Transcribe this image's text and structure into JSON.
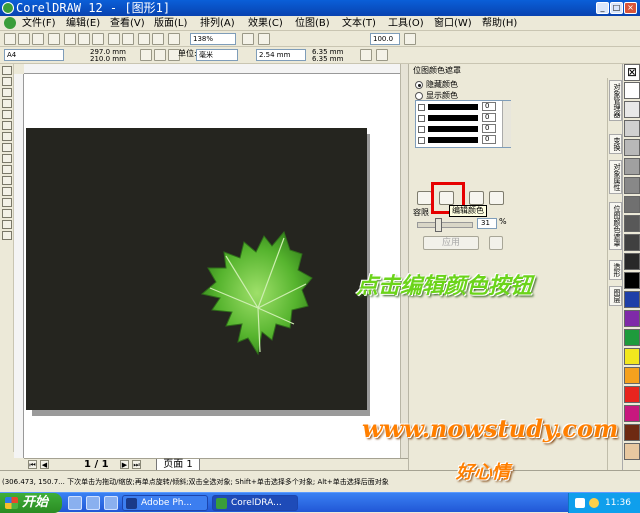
{
  "window": {
    "title": "CorelDRAW 12 - [图形1]"
  },
  "menu": [
    {
      "label": "文件(F)"
    },
    {
      "label": "编辑(E)"
    },
    {
      "label": "查看(V)"
    },
    {
      "label": "版面(L)"
    },
    {
      "label": "排列(A)"
    },
    {
      "label": "效果(C)"
    },
    {
      "label": "位图(B)"
    },
    {
      "label": "文本(T)"
    },
    {
      "label": "工具(O)"
    },
    {
      "label": "窗口(W)"
    },
    {
      "label": "帮助(H)"
    }
  ],
  "toolbar": {
    "zoom": "138%",
    "zoom2": "100.0"
  },
  "propbar": {
    "paper": "A4",
    "width": "297.0 mm",
    "height": "210.0 mm",
    "units_label": "单位:",
    "units": "毫米",
    "nudge": "2.54 mm",
    "dup_x": "6.35 mm",
    "dup_y": "6.35 mm"
  },
  "page_nav": {
    "count": "1 / 1",
    "tab": "页面 1"
  },
  "docker": {
    "title": "位图颜色遮罩",
    "hide_label": "隐藏颜色",
    "show_label": "显示颜色",
    "rows": [
      {
        "value": "0"
      },
      {
        "value": "0"
      },
      {
        "value": "0"
      },
      {
        "value": "0"
      }
    ],
    "tooltip": "编辑颜色",
    "tolerance_label": "容限",
    "tolerance_value": "31",
    "percent": "%",
    "apply_label": "应用",
    "tabs": [
      "对象管理器",
      "变换",
      "对象属性",
      "位图颜色遮罩",
      "造形",
      "图层"
    ]
  },
  "palette": [
    "#ffffff",
    "#e8e8e8",
    "#d0d0d0",
    "#b8b8b8",
    "#a0a0a0",
    "#888888",
    "#707070",
    "#585858",
    "#404040",
    "#282828",
    "#000000",
    "#1f3fa8",
    "#7f2aa8",
    "#1e9b3c",
    "#f2e71e",
    "#f5a11e",
    "#e8241e",
    "#c8187e",
    "#6e2a12",
    "#e8c8a0"
  ],
  "status": {
    "text": "(306.473, 150.7...  下次单击为拖动/缩放;再单点旋转/倾斜;双击全选对象; Shift+单击选择多个对象; Alt+单击选择后面对象"
  },
  "taskbar": {
    "start_label": "开始",
    "tasks": [
      {
        "label": "Adobe Ph..."
      },
      {
        "label": "CorelDRA..."
      }
    ],
    "clock": "11:36"
  },
  "overlay": {
    "instruction": "点击编辑颜色按钮",
    "url": "www.nowstudy.com",
    "signature": "好心情"
  }
}
